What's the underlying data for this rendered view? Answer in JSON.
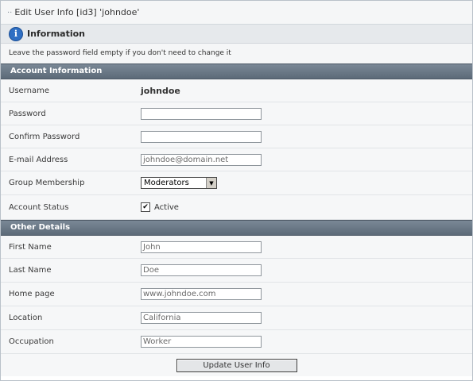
{
  "window": {
    "title": "Edit User Info [id3] 'johndoe'"
  },
  "info": {
    "icon": "info-icon",
    "title": "Information",
    "note": "Leave the password field empty if you don't need to change it"
  },
  "account_section": {
    "title": "Account Information",
    "username_label": "Username",
    "username_value": "johndoe",
    "password_label": "Password",
    "password_value": "",
    "confirm_label": "Confirm Password",
    "confirm_value": "",
    "email_label": "E-mail Address",
    "email_value": "johndoe@domain.net",
    "group_label": "Group Membership",
    "group_value": "Moderators",
    "status_label": "Account Status",
    "status_checked": true,
    "status_option": "Active"
  },
  "details_section": {
    "title": "Other Details",
    "first_label": "First Name",
    "first_value": "John",
    "last_label": "Last Name",
    "last_value": "Doe",
    "home_label": "Home page",
    "home_value": "www.johndoe.com",
    "location_label": "Location",
    "location_value": "California",
    "occupation_label": "Occupation",
    "occupation_value": "Worker"
  },
  "submit": {
    "label": "Update User Info"
  },
  "colors": {
    "section_header": "#5c6a78",
    "info_icon": "#2f6fc3"
  }
}
